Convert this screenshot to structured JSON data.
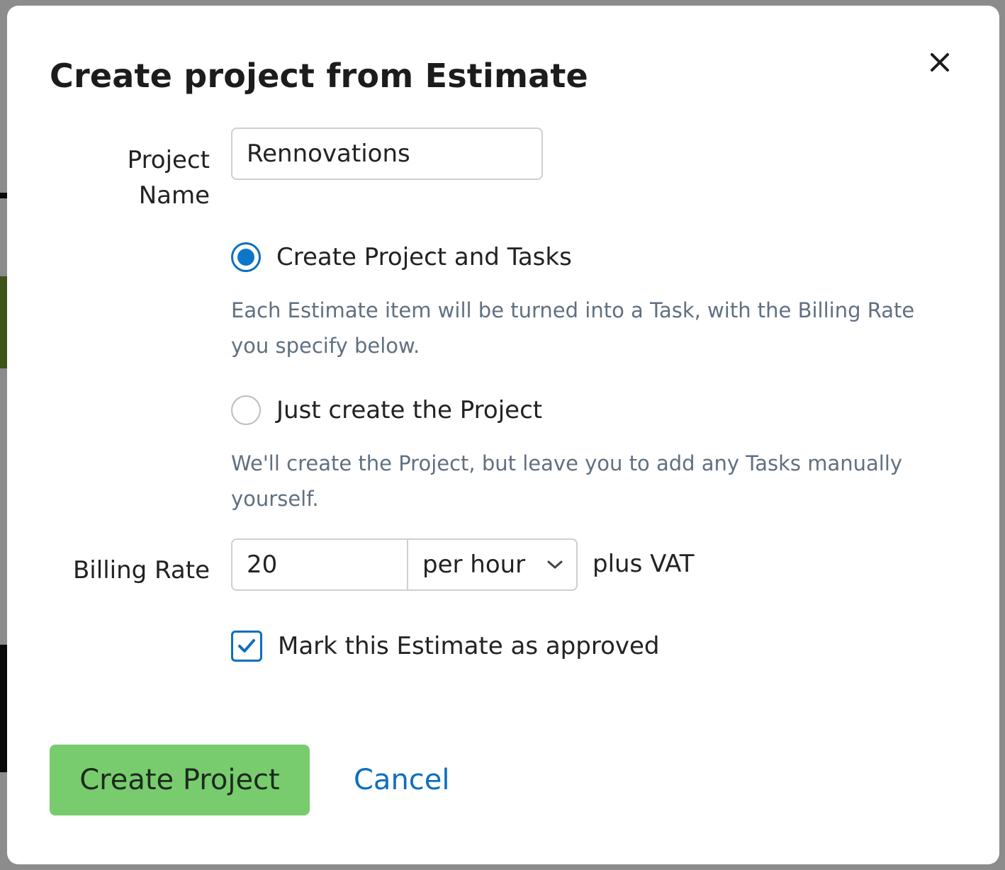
{
  "dialog": {
    "title": "Create project from Estimate",
    "close_icon": "close-icon"
  },
  "form": {
    "project_name": {
      "label": "Project Name",
      "value": "Rennovations"
    },
    "options": [
      {
        "label": "Create Project and Tasks",
        "help": "Each Estimate item will be turned into a Task, with the Billing Rate you specify below.",
        "selected": true
      },
      {
        "label": "Just create the Project",
        "help": "We'll create the Project, but leave you to add any Tasks manually yourself.",
        "selected": false
      }
    ],
    "billing_rate": {
      "label": "Billing Rate",
      "value": "20",
      "period": "per hour",
      "suffix": "plus VAT"
    },
    "approve": {
      "label": "Mark this Estimate as approved",
      "checked": true
    }
  },
  "actions": {
    "primary_label": "Create Project",
    "cancel_label": "Cancel"
  },
  "colors": {
    "accent": "#0d6fbf",
    "primary_button": "#78cc6e",
    "help_text": "#607080"
  }
}
